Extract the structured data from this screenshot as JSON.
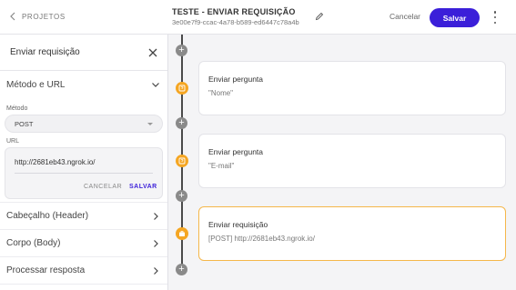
{
  "topbar": {
    "back_label": "PROJETOS",
    "title": "TESTE - ENVIAR REQUISIÇÃO",
    "subtitle": "3e00e7f9-ccac-4a78-b589-ed6447c78a4b",
    "cancel_label": "Cancelar",
    "save_label": "Salvar"
  },
  "panel": {
    "title": "Enviar requisição",
    "method_url_label": "Método e URL",
    "method_field_label": "Método",
    "method_value": "POST",
    "url_field_label": "URL",
    "url_value": "http://2681eb43.ngrok.io/",
    "url_cancel_label": "CANCELAR",
    "url_save_label": "SALVAR",
    "sections": [
      {
        "label": "Cabeçalho (Header)"
      },
      {
        "label": "Corpo (Body)"
      },
      {
        "label": "Processar resposta"
      }
    ]
  },
  "flow": {
    "nodes": [
      {
        "title": "Enviar pergunta",
        "subtitle": "\"Nome\"",
        "icon": "question-icon"
      },
      {
        "title": "Enviar pergunta",
        "subtitle": "\"E-mail\"",
        "icon": "question-icon"
      },
      {
        "title": "Enviar requisição",
        "subtitle": "[POST] http://2681eb43.ngrok.io/",
        "icon": "briefcase-icon"
      }
    ]
  },
  "colors": {
    "accent": "#3b1fd9",
    "node_icon": "#f5a623",
    "selected_border": "#f5b74a"
  }
}
